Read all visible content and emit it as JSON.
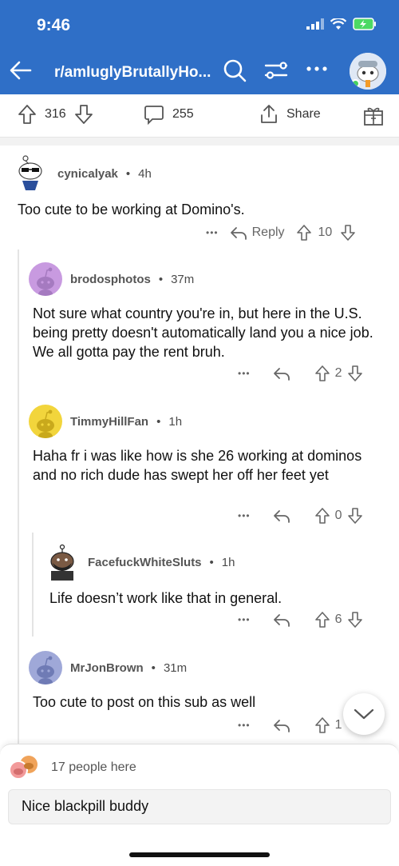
{
  "status": {
    "time": "9:46"
  },
  "header": {
    "subreddit": "r/amIuglyBrutallyHo..."
  },
  "actions": {
    "upvotes": "316",
    "comments": "255",
    "share_label": "Share"
  },
  "comments": [
    {
      "user": "cynicalyak",
      "age": "4h",
      "body": "Too cute to be working at Domino's.",
      "reply_label": "Reply",
      "votes": "10",
      "more": "•••"
    },
    {
      "user": "brodosphotos",
      "age": "37m",
      "body": "Not sure what country you're in, but here in the U.S. being pretty doesn't automatically land you a nice job. We all gotta pay the rent bruh.",
      "votes": "2",
      "more": "•••"
    },
    {
      "user": "TimmyHillFan",
      "age": "1h",
      "body": "Haha fr i was like how is she 26 working at dominos and no rich dude has swept her off her feet yet",
      "votes": "0",
      "more": "•••"
    },
    {
      "user": "FacefuckWhiteSluts",
      "age": "1h",
      "body": "Life doesn’t work like that in general.",
      "votes": "6",
      "more": "•••"
    },
    {
      "user": "MrJonBrown",
      "age": "31m",
      "body": "Too cute to post on this sub as well",
      "votes": "1",
      "more": "•••"
    }
  ],
  "bottom": {
    "people_here": "17 people here",
    "reply_text": "Nice blackpill buddy"
  },
  "separator": "•"
}
